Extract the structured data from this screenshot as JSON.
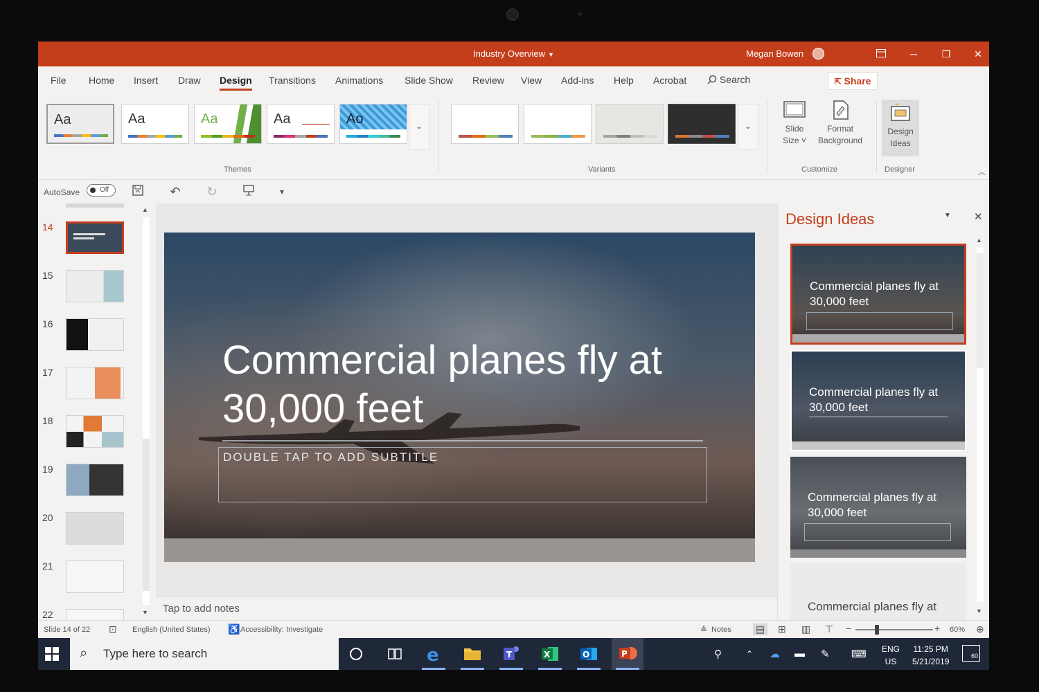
{
  "window": {
    "title": "Industry Overview",
    "user": "Megan Bowen",
    "accent": "#c43e1c"
  },
  "menu": {
    "tabs": [
      "File",
      "Home",
      "Insert",
      "Draw",
      "Design",
      "Transitions",
      "Animations",
      "Slide Show",
      "Review",
      "View",
      "Add-ins",
      "Help",
      "Acrobat"
    ],
    "active_tab": "Design",
    "search_label": "Search",
    "share_label": "Share"
  },
  "ribbon": {
    "themes_label": "Themes",
    "variants_label": "Variants",
    "customize_label": "Customize",
    "designer_label": "Designer",
    "theme_sample_text": [
      "Aa",
      "Aa",
      "Aa",
      "Aa",
      "Ao"
    ],
    "slide_size_label": [
      "Slide",
      "Size ˅"
    ],
    "format_background_label": [
      "Format",
      "Background"
    ],
    "design_ideas_label": [
      "Design",
      "Ideas"
    ]
  },
  "qat": {
    "autosave_label": "AutoSave",
    "autosave_state": "Off"
  },
  "thumbnails": {
    "numbers": [
      "14",
      "15",
      "16",
      "17",
      "18",
      "19",
      "20",
      "21",
      "22"
    ],
    "active": "14"
  },
  "slide": {
    "title": "Commercial planes fly at 30,000 feet",
    "subtitle_placeholder": "DOUBLE TAP TO ADD SUBTITLE",
    "notes_placeholder": "Tap to add notes"
  },
  "design_ideas": {
    "title": "Design Ideas",
    "ideas": [
      {
        "title": "Commercial planes fly at 30,000 feet"
      },
      {
        "title": "Commercial planes fly at 30,000 feet"
      },
      {
        "title": "Commercial planes fly at 30,000 feet"
      },
      {
        "title": "Commercial planes fly at"
      }
    ]
  },
  "status": {
    "slide_position": "Slide 14 of 22",
    "language": "English (United States)",
    "accessibility": "Accessibility: Investigate",
    "notes_label": "Notes",
    "zoom": "60%"
  },
  "taskbar": {
    "search_placeholder": "Type here to search",
    "lang_top": "ENG",
    "lang_bottom": "US",
    "time": "11:25 PM",
    "date": "5/21/2019",
    "notification_count": "60"
  }
}
